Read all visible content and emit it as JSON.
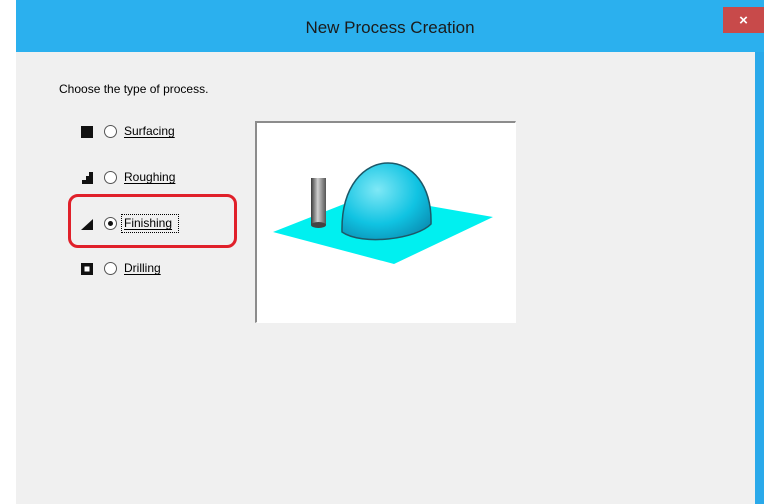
{
  "window": {
    "title": "New Process Creation",
    "close_label": "×"
  },
  "dialog": {
    "prompt": "Choose the type of process.",
    "options": [
      {
        "label": "Surfacing",
        "icon": "square-icon",
        "checked": false
      },
      {
        "label": "Roughing",
        "icon": "steps-icon",
        "checked": false
      },
      {
        "label": "Finishing",
        "icon": "slope-icon",
        "checked": true
      },
      {
        "label": "Drilling",
        "icon": "drill-hole-icon",
        "checked": false
      }
    ]
  },
  "colors": {
    "titlebar": "#2bb0ee",
    "close": "#c84a4a",
    "highlight": "#e0202a",
    "preview_plane": "#00f0f0",
    "preview_dome": "#00c2e0"
  }
}
